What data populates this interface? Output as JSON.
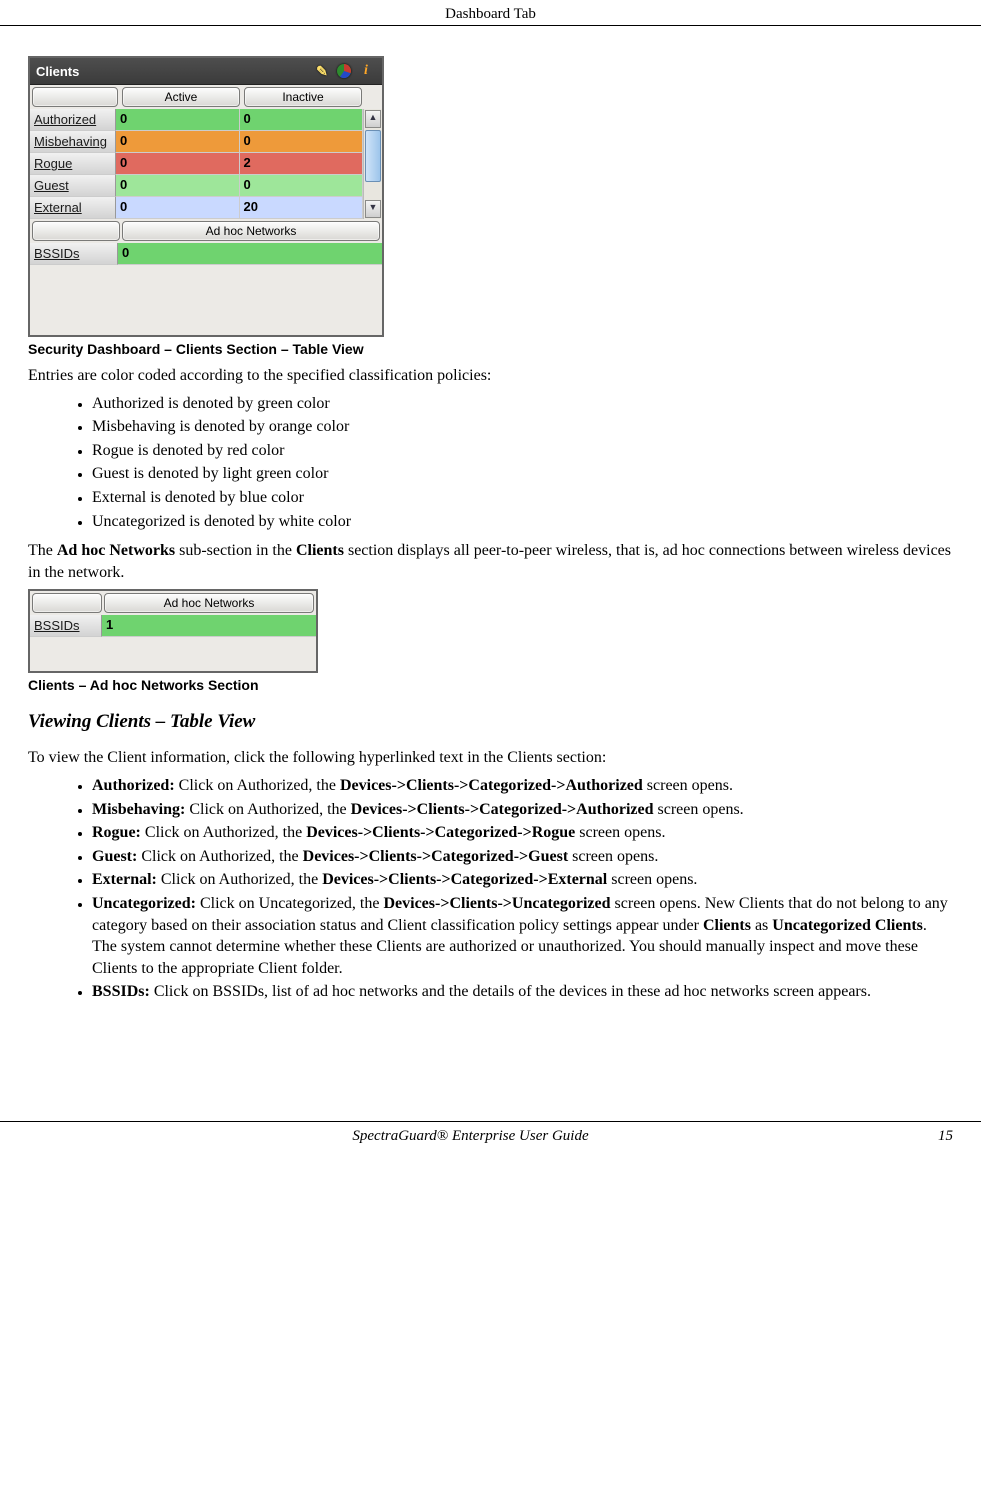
{
  "header": {
    "running": "Dashboard Tab"
  },
  "widget1": {
    "title": "Clients",
    "icons": {
      "note": "note-icon",
      "pie": "pie-icon",
      "info": "info-icon"
    },
    "cols": {
      "blank": "",
      "active": "Active",
      "inactive": "Inactive"
    },
    "rows": [
      {
        "label": "Authorized",
        "active": "0",
        "inactive": "0",
        "cls": "c-green"
      },
      {
        "label": "Misbehaving",
        "active": "0",
        "inactive": "0",
        "cls": "c-orange"
      },
      {
        "label": "Rogue",
        "active": "0",
        "inactive": "2",
        "cls": "c-red"
      },
      {
        "label": "Guest",
        "active": "0",
        "inactive": "0",
        "cls": "c-ltgreen"
      },
      {
        "label": "External",
        "active": "0",
        "inactive": "20",
        "cls": "c-blue"
      }
    ],
    "adhoc_label": "Ad hoc Networks",
    "bssids_label": "BSSIDs",
    "bssids_value": "0"
  },
  "caption1": "Security Dashboard – Clients Section – Table View",
  "para1": "Entries are color coded according to the specified classification policies:",
  "colorList": [
    "Authorized is denoted by green color",
    "Misbehaving is denoted by orange color",
    "Rogue is denoted by red color",
    "Guest is denoted by light green color",
    "External is denoted by blue color",
    "Uncategorized is denoted by white color"
  ],
  "para2_pre": "The ",
  "para2_b1": "Ad hoc Networks",
  "para2_mid": " sub-section in the ",
  "para2_b2": "Clients",
  "para2_post": " section displays all peer-to-peer wireless, that is, ad hoc connections between wireless devices in the network.",
  "widget2": {
    "adhoc_label": "Ad hoc Networks",
    "bssids_label": "BSSIDs",
    "bssids_value": "1"
  },
  "caption2": "Clients – Ad hoc Networks Section",
  "section_h": "Viewing Clients – Table View",
  "para3": "To view the Client information, click the following hyperlinked text in the Clients section:",
  "navList": [
    {
      "b": "Authorized:",
      "t1": " Click on Authorized, the ",
      "path": "Devices->Clients->Categorized->Authorized",
      "t2": " screen opens."
    },
    {
      "b": "Misbehaving:",
      "t1": " Click on Authorized, the ",
      "path": "Devices->Clients->Categorized->Authorized",
      "t2": " screen opens."
    },
    {
      "b": "Rogue:",
      "t1": " Click on Authorized, the ",
      "path": "Devices->Clients->Categorized->Rogue",
      "t2": " screen opens."
    },
    {
      "b": "Guest:",
      "t1": " Click on Authorized, the ",
      "path": "Devices->Clients->Categorized->Guest",
      "t2": " screen opens."
    },
    {
      "b": "External:",
      "t1": " Click on Authorized, the ",
      "path": "Devices->Clients->Categorized->External",
      "t2": " screen opens."
    },
    {
      "b": "Uncategorized:",
      "t1": " Click on Uncategorized, the ",
      "path": "Devices->Clients->Uncategorized",
      "t2": " screen opens. New Clients that do not belong to any category based on their association status and Client classification policy settings appear under ",
      "b2": "Clients",
      "t3": " as ",
      "b3": "Uncategorized Clients",
      "t4": ". The system cannot determine whether these Clients are authorized or unauthorized. You should manually inspect and move these Clients to the appropriate Client folder."
    },
    {
      "b": "BSSIDs:",
      "plain": " Click on BSSIDs, list of ad hoc networks and the details of the devices in these ad hoc networks screen appears."
    }
  ],
  "footer": {
    "title": "SpectraGuard®  Enterprise User Guide",
    "page": "15"
  }
}
